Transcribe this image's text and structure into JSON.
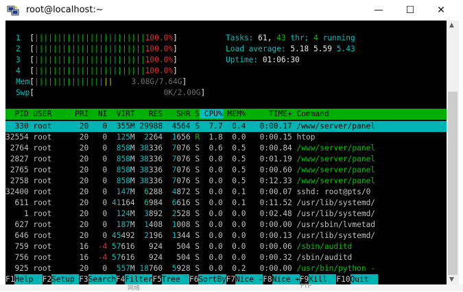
{
  "window": {
    "title": "root@localhost:~",
    "min": "—",
    "max": "☐",
    "close": "✕"
  },
  "meters": {
    "cpus": [
      {
        "id": "1",
        "bar": "||||||||||||||||||||||||",
        "pct": "100.0%"
      },
      {
        "id": "2",
        "bar": "||||||||||||||||||||||||",
        "pct": "100.0%"
      },
      {
        "id": "3",
        "bar": "||||||||||||||||||||||||",
        "pct": "100.0%"
      },
      {
        "id": "4",
        "bar": "||||||||||||||||||||||||",
        "pct": "100.0%"
      }
    ],
    "mem": {
      "label": "Mem",
      "value": "3.08G/7.64G"
    },
    "swp": {
      "label": "Swp",
      "value": "0K/2.00G"
    }
  },
  "summary": {
    "tasks_label": "Tasks:",
    "tasks": "61,",
    "thr": "43",
    "thr_label": "thr;",
    "running": "4",
    "running_label": "running",
    "load_label": "Load average:",
    "load1": "5.18",
    "load5": "5.59",
    "load15": "5.43",
    "uptime_label": "Uptime:",
    "uptime": "01:06:30"
  },
  "table": {
    "columns": [
      "PID",
      "USER",
      "PRI",
      "NI",
      "VIRT",
      "RES",
      "SHR",
      "S",
      "CPU%",
      "MEM%",
      "TIME+",
      "Command"
    ],
    "rows": [
      {
        "pid": "330",
        "user": "root",
        "pri": "20",
        "ni": "0",
        "virt": "355M",
        "res": "29988",
        "shr": "4564",
        "s": "S",
        "cpu": "7.7",
        "mem": "0.4",
        "time": "0:00.17",
        "cmd": "/www/server/panel"
      },
      {
        "pid": "32554",
        "user": "root",
        "pri": "20",
        "ni": "0",
        "virt": "125M",
        "res": "2264",
        "shr": "1656",
        "s": "R",
        "cpu": "1.8",
        "mem": "0.0",
        "time": "0:00.15",
        "cmd": "htop"
      },
      {
        "pid": "2764",
        "user": "root",
        "pri": "20",
        "ni": "0",
        "virt": "858M",
        "res": "38336",
        "shr": "7076",
        "s": "S",
        "cpu": "0.6",
        "mem": "0.5",
        "time": "0:00.84",
        "cmd": "/www/server/panel"
      },
      {
        "pid": "2827",
        "user": "root",
        "pri": "20",
        "ni": "0",
        "virt": "858M",
        "res": "38336",
        "shr": "7076",
        "s": "S",
        "cpu": "0.0",
        "mem": "0.5",
        "time": "0:01.19",
        "cmd": "/www/server/panel"
      },
      {
        "pid": "2765",
        "user": "root",
        "pri": "20",
        "ni": "0",
        "virt": "858M",
        "res": "38336",
        "shr": "7076",
        "s": "S",
        "cpu": "0.0",
        "mem": "0.5",
        "time": "0:00.60",
        "cmd": "/www/server/panel"
      },
      {
        "pid": "2758",
        "user": "root",
        "pri": "20",
        "ni": "0",
        "virt": "858M",
        "res": "38336",
        "shr": "7076",
        "s": "S",
        "cpu": "0.0",
        "mem": "0.5",
        "time": "0:12.33",
        "cmd": "/www/server/panel"
      },
      {
        "pid": "32400",
        "user": "root",
        "pri": "20",
        "ni": "0",
        "virt": "147M",
        "res": "6288",
        "shr": "4872",
        "s": "S",
        "cpu": "0.0",
        "mem": "0.1",
        "time": "0:00.07",
        "cmd": "sshd: root@pts/0"
      },
      {
        "pid": "611",
        "user": "root",
        "pri": "20",
        "ni": "0",
        "virt": "41164",
        "res": "6984",
        "shr": "6616",
        "s": "S",
        "cpu": "0.0",
        "mem": "0.1",
        "time": "0:11.52",
        "cmd": "/usr/lib/systemd/"
      },
      {
        "pid": "1",
        "user": "root",
        "pri": "20",
        "ni": "0",
        "virt": "124M",
        "res": "3892",
        "shr": "2528",
        "s": "S",
        "cpu": "0.0",
        "mem": "0.0",
        "time": "0:02.48",
        "cmd": "/usr/lib/systemd/"
      },
      {
        "pid": "627",
        "user": "root",
        "pri": "20",
        "ni": "0",
        "virt": "187M",
        "res": "1408",
        "shr": "1008",
        "s": "S",
        "cpu": "0.0",
        "mem": "0.0",
        "time": "0:00.00",
        "cmd": "/usr/sbin/lvmetad"
      },
      {
        "pid": "646",
        "user": "root",
        "pri": "20",
        "ni": "0",
        "virt": "45492",
        "res": "2196",
        "shr": "1344",
        "s": "S",
        "cpu": "0.0",
        "mem": "0.0",
        "time": "0:00.13",
        "cmd": "/usr/lib/systemd/"
      },
      {
        "pid": "759",
        "user": "root",
        "pri": "16",
        "ni": "-4",
        "virt": "57616",
        "res": "924",
        "shr": "504",
        "s": "S",
        "cpu": "0.0",
        "mem": "0.0",
        "time": "0:00.06",
        "cmd": "/sbin/auditd"
      },
      {
        "pid": "756",
        "user": "root",
        "pri": "16",
        "ni": "-4",
        "virt": "57616",
        "res": "924",
        "shr": "504",
        "s": "S",
        "cpu": "0.0",
        "mem": "0.0",
        "time": "0:00.32",
        "cmd": "/sbin/auditd"
      },
      {
        "pid": "925",
        "user": "root",
        "pri": "20",
        "ni": "0",
        "virt": "557M",
        "res": "18760",
        "shr": "5928",
        "s": "S",
        "cpu": "0.0",
        "mem": "0.2",
        "time": "0:00.00",
        "cmd": "/usr/bin/python -"
      }
    ]
  },
  "fkeys": [
    {
      "key": "F1",
      "label": "Help  "
    },
    {
      "key": "F2",
      "label": "Setup "
    },
    {
      "key": "F3",
      "label": "Search"
    },
    {
      "key": "F4",
      "label": "Filter"
    },
    {
      "key": "F5",
      "label": "Tree  "
    },
    {
      "key": "F6",
      "label": "SortBy"
    },
    {
      "key": "F7",
      "label": "Nice -"
    },
    {
      "key": "F8",
      "label": "Nice +"
    },
    {
      "key": "F9",
      "label": "Kill  "
    },
    {
      "key": "F10",
      "label": "Quit  "
    }
  ],
  "behind": {
    "left": "网络",
    "right": "FTP"
  },
  "colors": {
    "term_bg": "#000000",
    "header_bg": "#00b000",
    "selection_bg": "#00b4b4",
    "green": "#00c000",
    "red": "#e03030",
    "cyan": "#00c0c0"
  }
}
